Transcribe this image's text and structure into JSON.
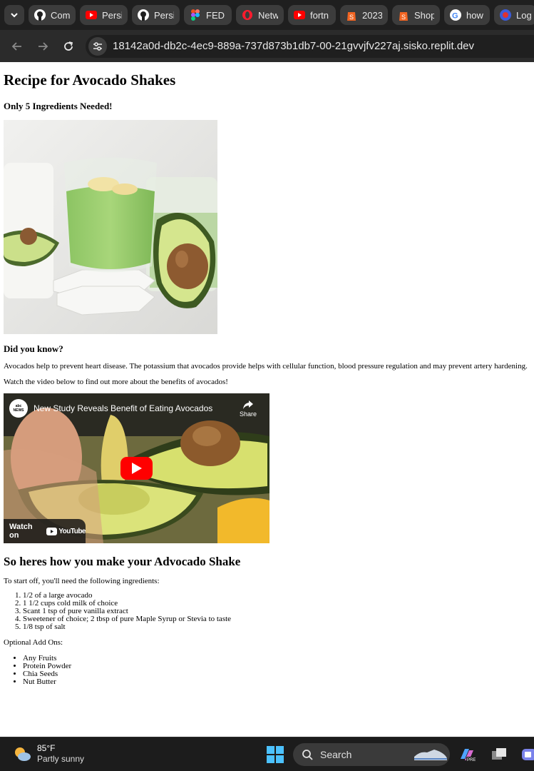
{
  "browser": {
    "tabs": [
      {
        "title": "Com",
        "icon": "github-icon"
      },
      {
        "title": "Persi",
        "icon": "youtube-icon"
      },
      {
        "title": "Persi",
        "icon": "github-icon"
      },
      {
        "title": "FED /",
        "icon": "figma-icon"
      },
      {
        "title": "Netw",
        "icon": "opera-icon"
      },
      {
        "title": "fortn",
        "icon": "youtube-icon"
      },
      {
        "title": "2023",
        "icon": "shopify-icon"
      },
      {
        "title": "Shop",
        "icon": "shopify-icon"
      },
      {
        "title": "how",
        "icon": "google-icon"
      },
      {
        "title": "Logi",
        "icon": "login-icon"
      }
    ],
    "url": "18142a0d-db2c-4ec9-889a-737d873b1db7-00-21gvvjfv227aj.sisko.replit.dev"
  },
  "page": {
    "title": "Recipe for Avocado Shakes",
    "subtitle": "Only 5 Ingredients Needed!",
    "did_you_know": "Did you know?",
    "fact": "Avocados help to prevent heart disease. The potassium that avocados provide helps with cellular function, blood pressure regulation and may prevent artery hardening.",
    "video_intro": "Watch the video below to find out more about the benefits of avocados!",
    "video": {
      "channel": "abc NEWS",
      "title": "New Study Reveals Benefit of Eating Avocados",
      "share": "Share",
      "watch_on": "Watch on",
      "youtube": "YouTube"
    },
    "howto_heading": "So heres how you make your Advocado Shake",
    "ingredients_intro": "To start off, you'll need the following ingredients:",
    "ingredients": [
      "1/2 of a large avocado",
      "1 1/2 cups cold milk of choice",
      "Scant 1 tsp of pure vanilla extract",
      "Sweetener of choice; 2 tbsp of pure Maple Syrup or Stevia to taste",
      "1/8 tsp of salt"
    ],
    "addons_intro": "Optional Add Ons:",
    "addons": [
      "Any Fruits",
      "Protein Powder",
      "Chia Seeds",
      "Nut Butter"
    ]
  },
  "taskbar": {
    "temperature": "85°F",
    "condition": "Partly sunny",
    "search_label": "Search"
  }
}
